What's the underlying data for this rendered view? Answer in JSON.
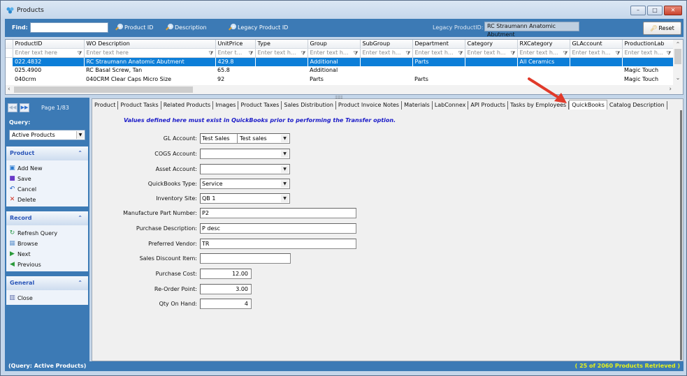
{
  "window": {
    "title": "Products",
    "controls": {
      "minimize": "–",
      "maximize": "□",
      "close": "✕"
    }
  },
  "findbar": {
    "find_label": "Find:",
    "find_value": "",
    "search_options": [
      "Product ID",
      "Description",
      "Legacy Product ID"
    ],
    "legacy_label": "Legacy ProductID:",
    "legacy_value": "RC Straumann Anatomic Abutment",
    "reset_label": "Reset"
  },
  "grid": {
    "columns": [
      "ProductID",
      "WO Description",
      "UnitPrice",
      "Type",
      "Group",
      "SubGroup",
      "Department",
      "Category",
      "RXCategory",
      "GLAccount",
      "ProductionLab"
    ],
    "filters": [
      "Enter text here",
      "Enter text here",
      "Enter t...",
      "Enter text h...",
      "Enter text h...",
      "Enter text h...",
      "Enter text h...",
      "Enter text h...",
      "Enter text h...",
      "Enter text h...",
      "Enter text h..."
    ],
    "rows": [
      {
        "selected": true,
        "cells": [
          "022.4832",
          "RC Straumann Anatomic Abutment",
          "429.8",
          "",
          "Additional",
          "",
          "Parts",
          "",
          "All Ceramics",
          "",
          ""
        ]
      },
      {
        "selected": false,
        "cells": [
          "025.4900",
          "RC Basal Screw, Tan",
          "65.8",
          "",
          "Additional",
          "",
          "",
          "",
          "",
          "",
          "Magic Touch"
        ]
      },
      {
        "selected": false,
        "cells": [
          "040crm",
          "040CRM Clear Caps Micro Size",
          "92",
          "",
          "Parts",
          "",
          "Parts",
          "",
          "",
          "",
          "Magic Touch"
        ]
      }
    ]
  },
  "sidebar": {
    "page_label": "Page 1/83",
    "query_label": "Query:",
    "query_value": "Active Products",
    "panels": [
      {
        "title": "Product",
        "items": [
          {
            "label": "Add New",
            "icon": "add-new-icon"
          },
          {
            "label": "Save",
            "icon": "save-icon"
          },
          {
            "label": "Cancel",
            "icon": "cancel-icon"
          },
          {
            "label": "Delete",
            "icon": "delete-icon"
          }
        ]
      },
      {
        "title": "Record",
        "items": [
          {
            "label": "Refresh Query",
            "icon": "refresh-icon"
          },
          {
            "label": "Browse",
            "icon": "browse-icon"
          },
          {
            "label": "Next",
            "icon": "next-icon"
          },
          {
            "label": "Previous",
            "icon": "previous-icon"
          }
        ]
      },
      {
        "title": "General",
        "items": [
          {
            "label": "Close",
            "icon": "close-door-icon"
          }
        ]
      }
    ]
  },
  "tabs": {
    "items": [
      "Product",
      "Product Tasks",
      "Related Products",
      "Images",
      "Product Taxes",
      "Sales Distribution",
      "Product Invoice Notes",
      "Materials",
      "LabConnex",
      "API Products",
      "Tasks by Employees",
      "QuickBooks",
      "Catalog Description"
    ],
    "active": "QuickBooks"
  },
  "quickbooks": {
    "notice": "Values defined here must exist in QuickBooks prior to performing the Transfer option.",
    "fields": {
      "gl_account": {
        "label": "GL Account:",
        "value": "Test Sales",
        "value2": "Test sales"
      },
      "cogs_account": {
        "label": "COGS Account:",
        "value": ""
      },
      "asset_account": {
        "label": "Asset Account:",
        "value": ""
      },
      "quickbooks_type": {
        "label": "QuickBooks Type:",
        "value": "Service"
      },
      "inventory_site": {
        "label": "Inventory Site:",
        "value": "QB 1"
      },
      "manufacture_part_number": {
        "label": "Manufacture Part Number:",
        "value": "P2"
      },
      "purchase_description": {
        "label": "Purchase Description:",
        "value": "P desc"
      },
      "preferred_vendor": {
        "label": "Preferred Vendor:",
        "value": "TR"
      },
      "sales_discount_item": {
        "label": "Sales Discount Item:",
        "value": ""
      },
      "purchase_cost": {
        "label": "Purchase Cost:",
        "value": "12.00"
      },
      "reorder_point": {
        "label": "Re-Order Point:",
        "value": "3.00"
      },
      "qty_on_hand": {
        "label": "Qty On Hand:",
        "value": "4"
      }
    }
  },
  "status": {
    "left": "(Query: Active Products)",
    "right": "( 25 of 2060 Products Retrieved )"
  },
  "colors": {
    "accent_blue": "#3c7ab5",
    "selection": "#0c7ed8",
    "notice_text": "#1a1ac8",
    "status_highlight": "#e6f21a",
    "annotation_arrow": "#e03a2a"
  }
}
